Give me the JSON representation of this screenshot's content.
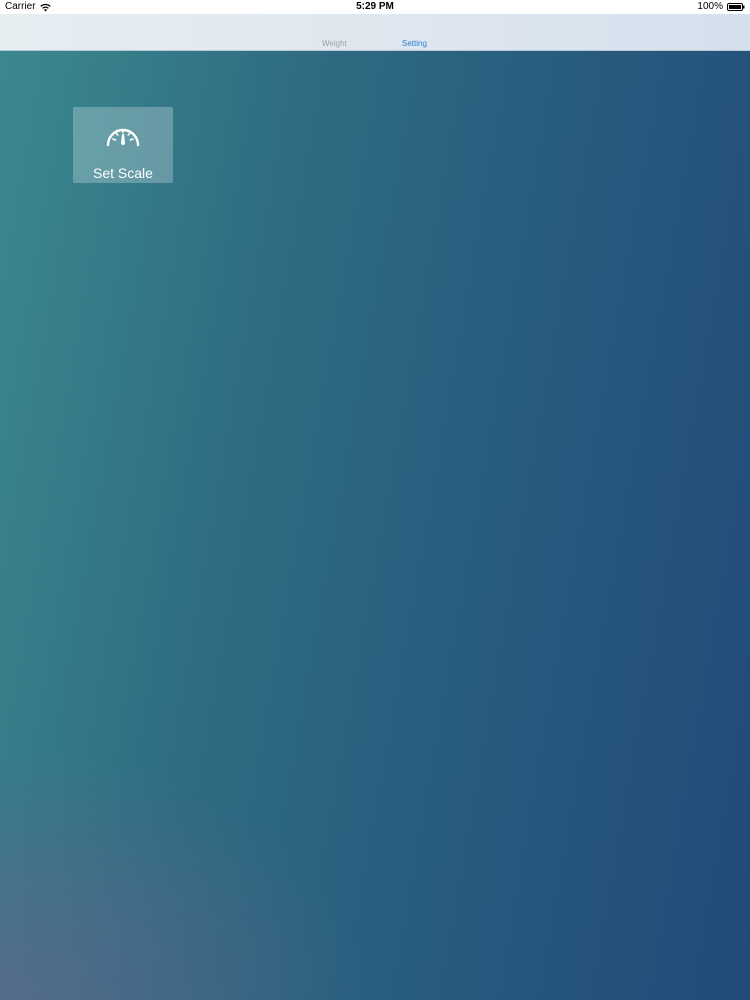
{
  "status_bar": {
    "carrier": "Carrier",
    "time": "5:29 PM",
    "battery": "100%"
  },
  "tabs": [
    {
      "label": "Weight",
      "selected": false
    },
    {
      "label": "Setting",
      "selected": true
    }
  ],
  "tiles": [
    {
      "label": "Set Scale",
      "icon": "speedometer-icon"
    }
  ],
  "colors": {
    "accent": "#2f7fd0",
    "tab_inactive": "#9aa3aa",
    "background_start": "#3b8a8f",
    "background_end": "#214a78"
  }
}
